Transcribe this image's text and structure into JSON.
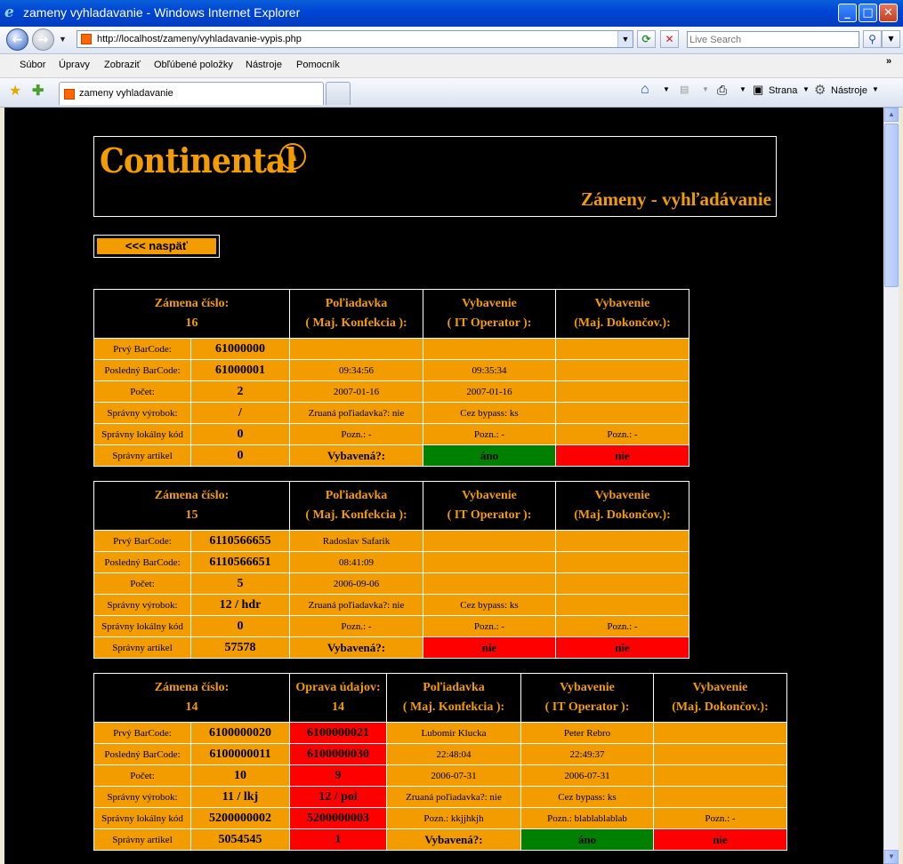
{
  "window": {
    "title": "zameny vyhladavanie - Windows Internet Explorer",
    "address": "http://localhost/zameny/vyhladavanie-vypis.php",
    "search_placeholder": "Live Search",
    "tab_title": "zameny vyhladavanie"
  },
  "menu": [
    "Súbor",
    "Úpravy",
    "Zobraziť",
    "Obľúbené položky",
    "Nástroje",
    "Pomocník"
  ],
  "toolbar": {
    "page_label": "Strana",
    "tools_label": "Nástroje"
  },
  "header": {
    "logo_text": "Continental",
    "page_title": "Zámeny - vyhľadávanie"
  },
  "back_button": "<<< naspäť",
  "labels": {
    "zamena": "Zámena číslo:",
    "oprava": "Oprava údajov:",
    "poziadavka_1": "Poľiadavka",
    "poziadavka_2": "( Maj. Konfekcia ):",
    "it_1": "Vybavenie",
    "it_2": "( IT Operator ):",
    "dok_1": "Vybavenie",
    "dok_2": "(Maj. Dokončov.):",
    "row_labels": [
      "Prvý BarCode:",
      "Posledný BarCode:",
      "Počet:",
      "Správny výrobok:",
      "Správny lokálny kód",
      "Správny artikel"
    ],
    "vybavena": "Vybavená?:"
  },
  "records": [
    {
      "id": "16",
      "values": [
        "61000000",
        "61000001",
        "2",
        "/",
        "0",
        "0"
      ],
      "poziadavka": [
        "",
        "09:34:56",
        "2007-01-16",
        "Zruaná poľiadavka?: nie",
        "Pozn.: -"
      ],
      "it": [
        "",
        "09:35:34",
        "2007-01-16",
        "Cez bypass: ks",
        "Pozn.: -"
      ],
      "dok": [
        "",
        "",
        "",
        "",
        "Pozn.: -"
      ],
      "it_status": "áno",
      "dok_status": "nie",
      "colors": {
        "yes": "#008000",
        "no": "#ff0000"
      }
    },
    {
      "id": "15",
      "values": [
        "6110566655",
        "6110566651",
        "5",
        "12 / hdr",
        "0",
        "57578"
      ],
      "poziadavka": [
        "Radoslav Safarik",
        "08:41:09",
        "2006-09-06",
        "Zruaná poľiadavka?: nie",
        "Pozn.: -"
      ],
      "it": [
        "",
        "",
        "",
        "Cez bypass: ks",
        "Pozn.: -"
      ],
      "dok": [
        "",
        "",
        "",
        "",
        "Pozn.: -"
      ],
      "it_status": "nie",
      "dok_status": "nie"
    },
    {
      "id": "14",
      "values": [
        "6100000020",
        "6100000011",
        "10",
        "11 / lkj",
        "5200000002",
        "5054545"
      ],
      "oprava": [
        "6100000021",
        "6100000030",
        "9",
        "12 / poi",
        "5200000003",
        "1"
      ],
      "poziadavka": [
        "Lubomir Klucka",
        "22:48:04",
        "2006-07-31",
        "Zruaná poľiadavka?: nie",
        "Pozn.: kkjjhkjh"
      ],
      "it": [
        "Peter Rebro",
        "22:49:37",
        "2006-07-31",
        "Cez bypass: ks",
        "Pozn.: blablablablab"
      ],
      "dok": [
        "",
        "",
        "",
        "",
        "Pozn.: -"
      ],
      "it_status": "áno",
      "dok_status": "nie"
    }
  ]
}
